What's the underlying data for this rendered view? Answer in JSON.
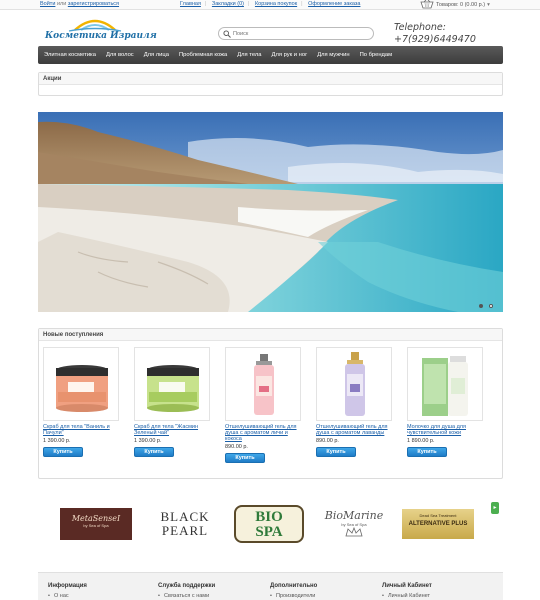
{
  "topbar": {
    "login_text": "Войти",
    "or_text": "или",
    "register_text": "зарегистрироваться",
    "links": [
      "Главная",
      "Закладки (0)",
      "Корзина покупок",
      "Оформление заказа"
    ],
    "cart_text": "Товаров: 0 (0.00 р.)"
  },
  "header": {
    "logo_text": "Косметика Израиля",
    "search_placeholder": "Поиск",
    "phone_label": "Telephone:",
    "phone_number": "+7(929)6449470"
  },
  "nav": {
    "items": [
      "Элитная косметика",
      "Для волос",
      "Для лица",
      "Проблемная кожа",
      "Для тела",
      "Для рук и ног",
      "Для мужчин",
      "По брендам"
    ]
  },
  "promo": {
    "title": "Акции"
  },
  "slider": {
    "slides": 2,
    "active": 2
  },
  "products": {
    "title": "Новые поступления",
    "buy_label": "Купить",
    "items": [
      {
        "name": "Скраб для тела \"Ваниль и Пачули\"",
        "price": "1 390.00 р."
      },
      {
        "name": "Скраб для тела \"Жасмин Зеленый чай\"",
        "price": "1 390.00 р."
      },
      {
        "name": "Отшелушивающий гель для душа с ароматом личи и кокоса",
        "price": "890.00 р."
      },
      {
        "name": "Отшелушивающий гель для душа с ароматом лаванды",
        "price": "890.00 р."
      },
      {
        "name": "Молочко для душа для чувствительной кожи",
        "price": "1 890.00 р."
      }
    ]
  },
  "brands": {
    "items": [
      "MetaSenseI",
      "by Sea of Spa",
      "BLACK",
      "PEARL",
      "BIO",
      "SPA",
      "BioMarine",
      "by Sea of Spa",
      "Dead Sea Treatment",
      "ALTERNATIVE PLUS"
    ]
  },
  "footer": {
    "columns": [
      {
        "title": "Информация",
        "link": "О нас"
      },
      {
        "title": "Служба поддержки",
        "link": "Связаться с нами"
      },
      {
        "title": "Дополнительно",
        "link": "Производители"
      },
      {
        "title": "Личный Кабинет",
        "link": "Личный Кабинет"
      }
    ]
  },
  "colors": {
    "accent": "#1f7cc7",
    "nav_bg": "#444444",
    "link": "#1a5fa8"
  }
}
